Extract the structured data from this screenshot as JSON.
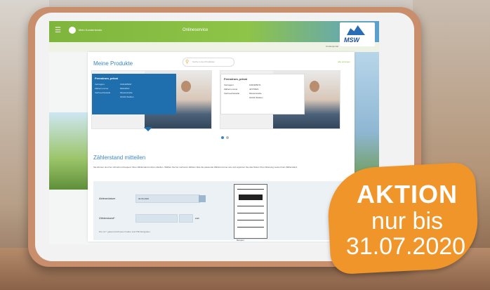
{
  "header": {
    "portal_title": "Onlineservice",
    "user_label": "Mein Kundenkonto",
    "logo_text": "MSW",
    "subbar_text": "Kundenportal"
  },
  "products": {
    "title": "Meine Produkte",
    "search_placeholder": "Suche in den Produkten",
    "all_link": "alle anzeigen",
    "cards": [
      {
        "title": "Fernstrom, privat",
        "rows": [
          {
            "k": "Vertragsnr.",
            "v": "1001965097"
          },
          {
            "k": "Zählernummer",
            "v": "83021813"
          },
          {
            "k": "Verbrauchsstelle",
            "v": "Musterstraße"
          },
          {
            "k": "",
            "v": "01234 Weißen"
          }
        ]
      },
      {
        "title": "Fernstrom, privat",
        "rows": [
          {
            "k": "Vertragsnr.",
            "v": "1001965071"
          },
          {
            "k": "Zählernummer",
            "v": "43770821"
          },
          {
            "k": "Verbrauchsstelle",
            "v": "Musterstraße"
          },
          {
            "k": "",
            "v": "01234 Weißen"
          }
        ]
      }
    ]
  },
  "meter": {
    "title": "Zählerstand mitteilen",
    "intro": "Sie können uns hier schnell und bequem Ihren Zählerstand online mitteilen. Wählen Sie bei mehreren Zählern bitte die passende Zählernummer aus und ergänzen Sie das Datum Ihrer Ablesung sowie Ihren Zählerstand.",
    "date_label": "Ablesedatum",
    "date_value": "02.06.2020",
    "reading_label": "Zählerstand*",
    "unit": "kWh",
    "note": "Die mit * gekennzeichneten Felder sind Pflichtangaben.",
    "image_caption": "Beispiel"
  },
  "badge": {
    "line1": "AKTION",
    "line2": "nur bis",
    "line3": "31.07.2020"
  },
  "colors": {
    "brand_green": "#8ec447",
    "brand_blue": "#1f6fae",
    "badge_orange": "#f0952a"
  }
}
